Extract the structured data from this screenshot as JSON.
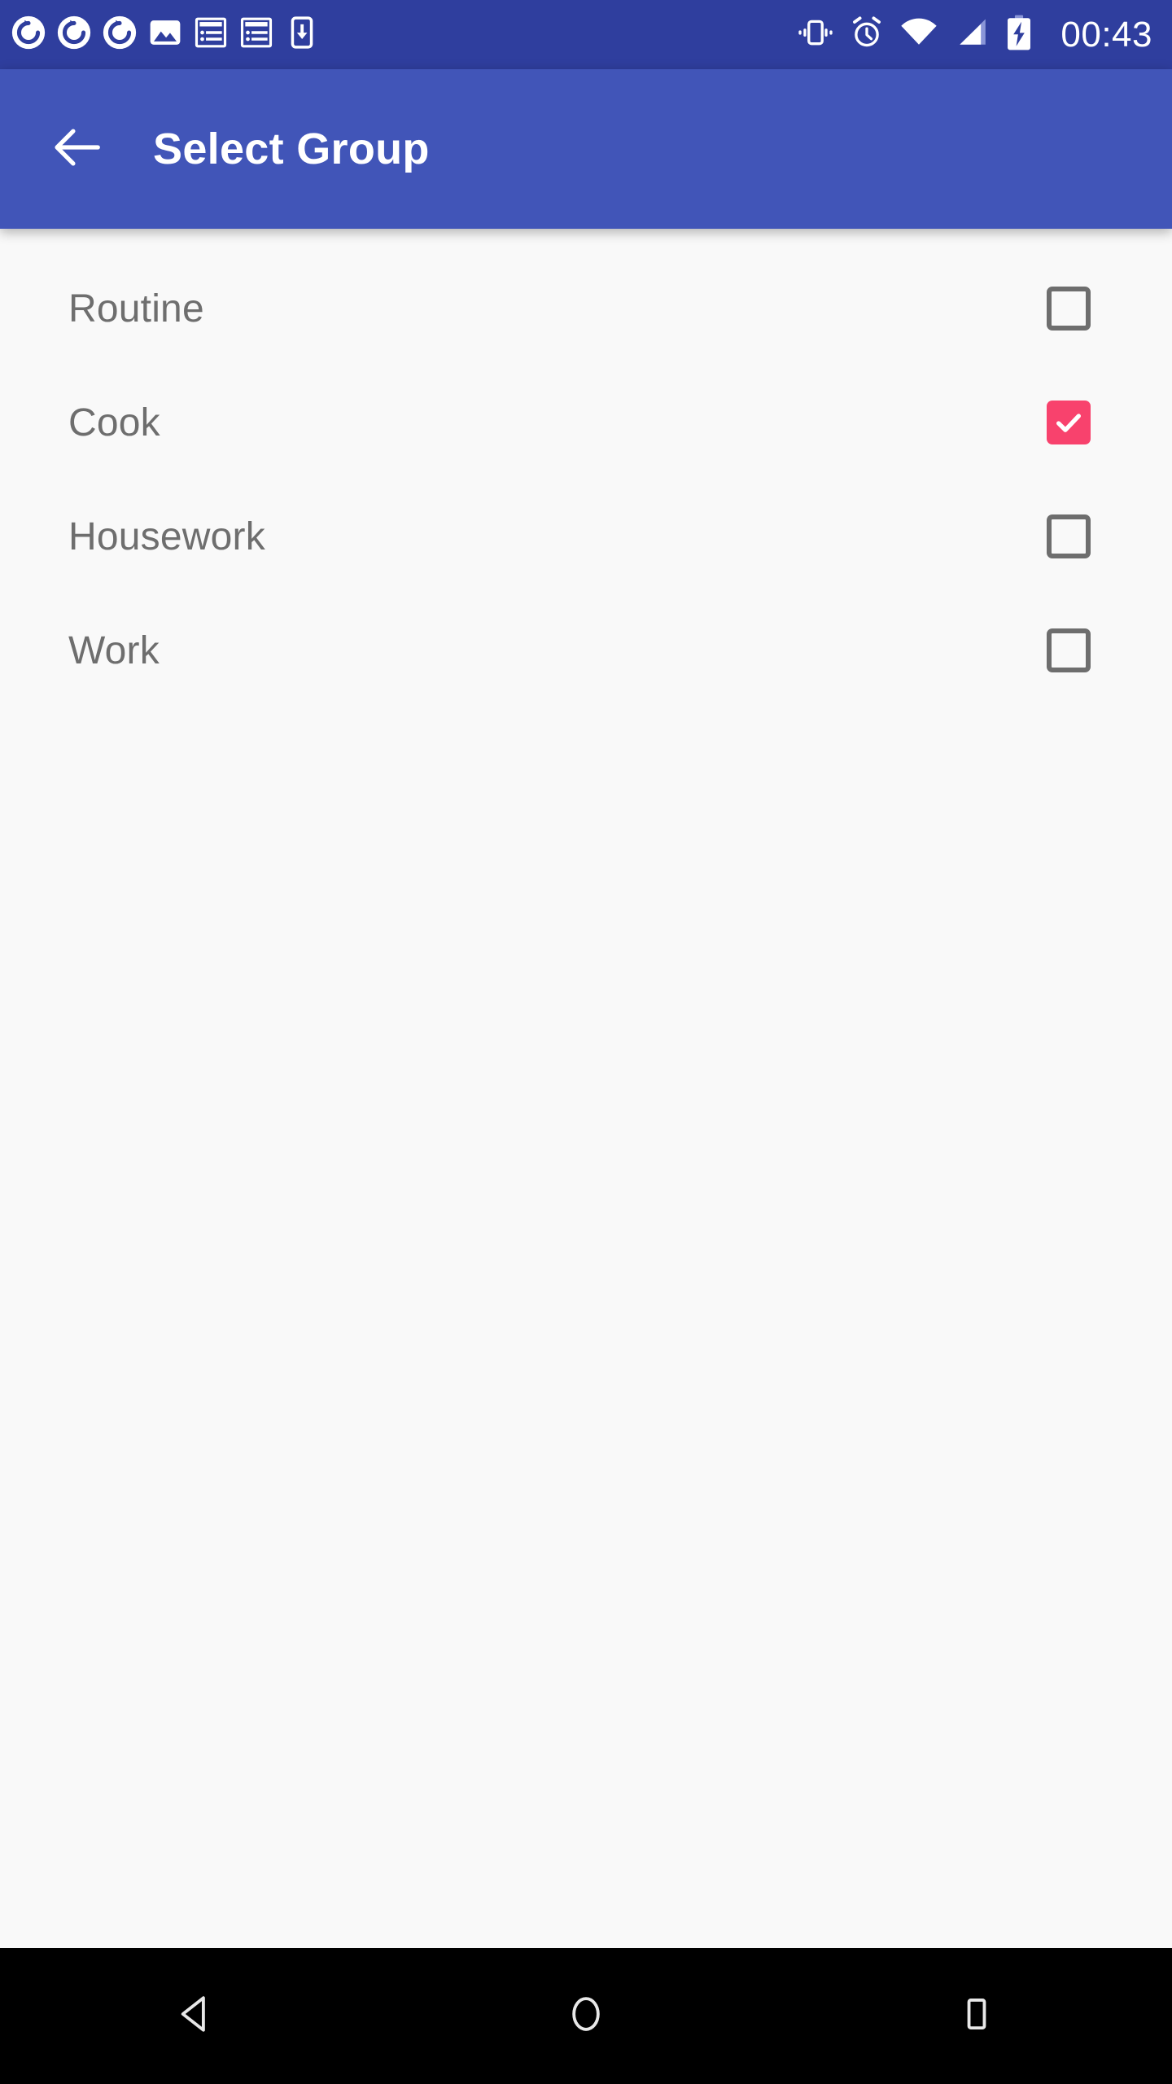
{
  "status_bar": {
    "background_color": "#2F3E9E",
    "clock": "00:43",
    "left_icons": [
      {
        "name": "sync-icon-1",
        "label": "sync"
      },
      {
        "name": "sync-icon-2",
        "label": "sync"
      },
      {
        "name": "sync-icon-3",
        "label": "sync"
      },
      {
        "name": "image-icon",
        "label": "image"
      },
      {
        "name": "article-icon-1",
        "label": "article"
      },
      {
        "name": "article-icon-2",
        "label": "article"
      },
      {
        "name": "download-to-phone-icon",
        "label": "download"
      }
    ],
    "right_icons": [
      {
        "name": "vibrate-icon",
        "label": "vibrate"
      },
      {
        "name": "alarm-icon",
        "label": "alarm"
      },
      {
        "name": "wifi-icon",
        "label": "wifi"
      },
      {
        "name": "signal-icon",
        "label": "signal"
      },
      {
        "name": "battery-charging-icon",
        "label": "battery charging"
      }
    ]
  },
  "app_bar": {
    "background_color": "#4155B8",
    "title": "Select Group",
    "back_icon": "arrow-left-icon"
  },
  "content": {
    "background_color": "#F9F9F9",
    "accent_color": "#F8426D",
    "label_color": "#6E6E6E",
    "rows": [
      {
        "label": "Routine",
        "checked": false
      },
      {
        "label": "Cook",
        "checked": true
      },
      {
        "label": "Housework",
        "checked": false
      },
      {
        "label": "Work",
        "checked": false
      }
    ]
  },
  "nav_bar": {
    "background_color": "#000000",
    "buttons": [
      {
        "name": "nav-back-button",
        "icon": "triangle-left-icon"
      },
      {
        "name": "nav-home-button",
        "icon": "circle-icon"
      },
      {
        "name": "nav-recents-button",
        "icon": "square-icon"
      }
    ]
  }
}
